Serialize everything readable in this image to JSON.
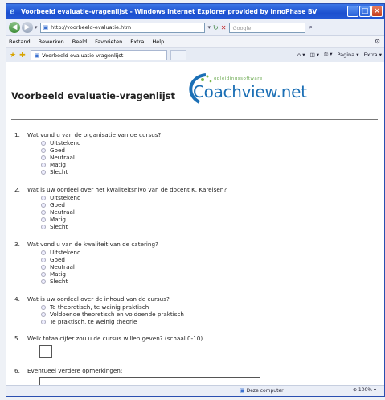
{
  "window": {
    "title": "Voorbeeld evaluatie-vragenlijst - Windows Internet Explorer provided by InnoPhase BV",
    "controls": [
      "_",
      "□",
      "×"
    ]
  },
  "address_bar": {
    "url": "http://voorbeeld-evaluatie.htm",
    "search_placeholder": "Google"
  },
  "menu": {
    "items": [
      "Bestand",
      "Bewerken",
      "Beeld",
      "Favorieten",
      "Extra",
      "Help"
    ]
  },
  "tab": {
    "title": "Voorbeeld evaluatie-vragenlijst"
  },
  "command_bar": {
    "items": [
      "Pagina ▾",
      "Extra ▾"
    ]
  },
  "page": {
    "title": "Voorbeeld evaluatie-vragenlijst",
    "logo_tagline": "opleidingssoftware",
    "logo_text": "Coachview.net",
    "questions": [
      {
        "num": "1.",
        "text": "Wat vond u van de organisatie van de cursus?",
        "options": [
          "Uitstekend",
          "Goed",
          "Neutraal",
          "Matig",
          "Slecht"
        ]
      },
      {
        "num": "2.",
        "text": "Wat is uw oordeel over het kwaliteitsnivo van de docent K. Karelsen?",
        "options": [
          "Uitstekend",
          "Goed",
          "Neutraal",
          "Matig",
          "Slecht"
        ]
      },
      {
        "num": "3.",
        "text": "Wat vond u van de kwaliteit van de catering?",
        "options": [
          "Uitstekend",
          "Goed",
          "Neutraal",
          "Matig",
          "Slecht"
        ]
      },
      {
        "num": "4.",
        "text": "Wat is uw oordeel over de inhoud van de cursus?",
        "options": [
          "Te theoretisch, te weinig praktisch",
          "Voldoende theoretisch en voldoende praktisch",
          "Te praktisch, te weinig theorie"
        ]
      },
      {
        "num": "5.",
        "text": "Welk totaalcijfer zou u de cursus willen geven? (schaal 0-10)"
      },
      {
        "num": "6.",
        "text": "Eventueel verdere opmerkingen:"
      }
    ]
  },
  "status_bar": {
    "zone": "Deze computer",
    "zoom": "100%"
  }
}
